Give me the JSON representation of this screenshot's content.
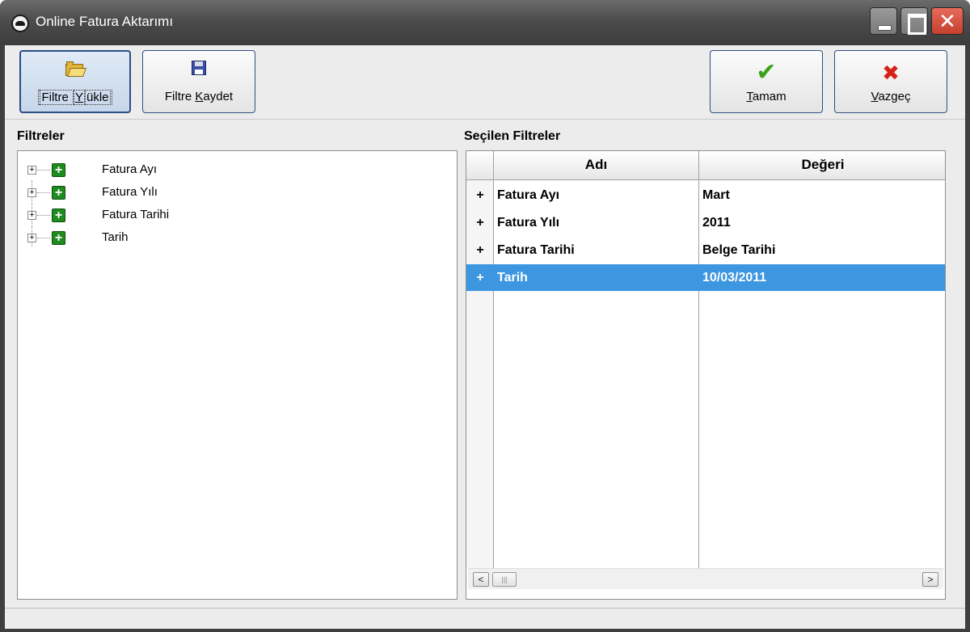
{
  "window": {
    "title": "Online Fatura Aktarımı",
    "close_glyph": "✕"
  },
  "toolbar": {
    "load_filter": {
      "prefix": "Filtre ",
      "accel": "Y",
      "suffix": "ükle",
      "icon": "folder-open-icon"
    },
    "save_filter": {
      "prefix": "Filtre ",
      "accel": "K",
      "suffix": "aydet",
      "icon": "floppy-disk-icon"
    },
    "ok": {
      "prefix": "",
      "accel": "T",
      "suffix": "amam",
      "icon": "checkmark-icon",
      "glyph": "✔"
    },
    "cancel": {
      "prefix": "",
      "accel": "V",
      "suffix": "azgeç",
      "icon": "cross-icon",
      "glyph": "✖"
    }
  },
  "filters": {
    "label": "Filtreler",
    "items": [
      {
        "label": "Fatura Ayı",
        "expander": "+",
        "add_glyph": "+"
      },
      {
        "label": "Fatura Yılı",
        "expander": "+",
        "add_glyph": "+"
      },
      {
        "label": "Fatura Tarihi",
        "expander": "+",
        "add_glyph": "+"
      },
      {
        "label": "Tarih",
        "expander": "+",
        "add_glyph": "+"
      }
    ]
  },
  "selected_filters": {
    "label": "Seçilen Filtreler",
    "columns": [
      "Adı",
      "Değeri"
    ],
    "rows": [
      {
        "indicator": "+",
        "name": "Fatura Ayı",
        "value": "Mart",
        "selected": false
      },
      {
        "indicator": "+",
        "name": "Fatura Yılı",
        "value": "2011",
        "selected": false
      },
      {
        "indicator": "+",
        "name": "Fatura Tarihi",
        "value": "Belge Tarihi",
        "selected": false
      },
      {
        "indicator": "+",
        "name": "Tarih",
        "value": "10/03/2011",
        "selected": true
      }
    ],
    "selection_color": "#3c96e0"
  },
  "scrollbar": {
    "left_arrow": "<",
    "right_arrow": ">",
    "thumb_grip": "|||"
  },
  "colors": {
    "titlebar": "#4c4c4c",
    "close_button": "#c4402e",
    "add_icon": "#1f8a1f"
  }
}
